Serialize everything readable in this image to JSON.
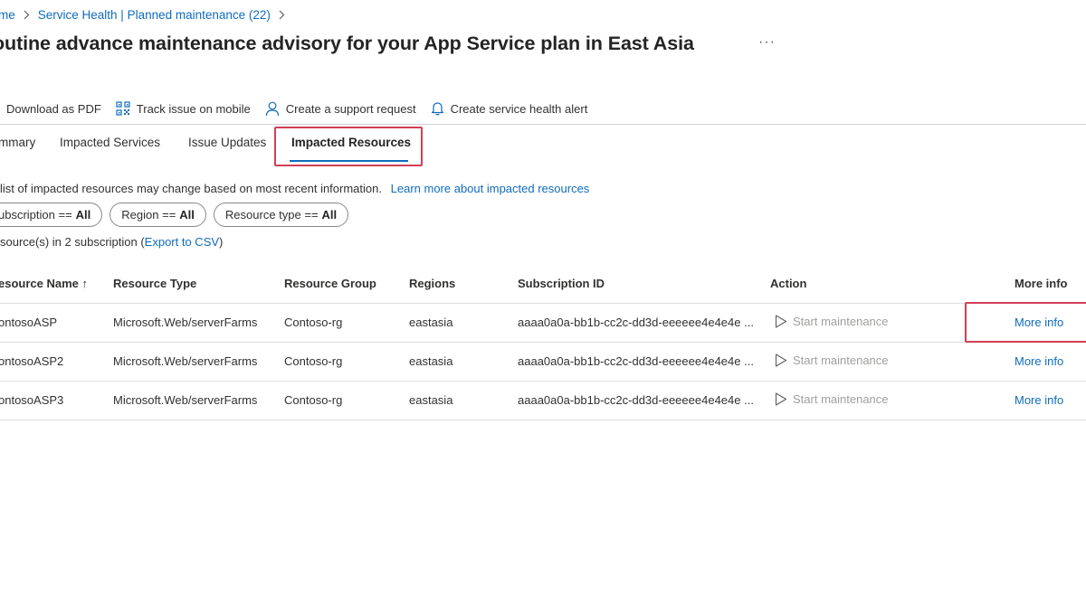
{
  "breadcrumb": {
    "home": "me",
    "current": "Service Health | Planned maintenance (22)"
  },
  "title": "outine advance maintenance advisory for your App Service plan in East Asia",
  "title_more": "···",
  "toolbar": {
    "download": "Download as PDF",
    "track": "Track issue on mobile",
    "support": "Create a support request",
    "alert": "Create service health alert"
  },
  "tabs": {
    "summary": "mmary",
    "impacted_services": "Impacted Services",
    "issue_updates": "Issue Updates",
    "impacted_resources": "Impacted Resources"
  },
  "info": {
    "text": "list of impacted resources may change based on most recent information.",
    "link": "Learn more about impacted resources"
  },
  "filters": {
    "subscription_label": "ubscription ==",
    "subscription_value": "All",
    "region_label": "Region ==",
    "region_value": "All",
    "resource_type_label": "Resource type ==",
    "resource_type_value": "All"
  },
  "count": {
    "prefix": "source(s) in 2 subscription (",
    "link": "Export to CSV",
    "suffix": ")"
  },
  "table": {
    "headers": {
      "name": "esource Name ↑",
      "type": "Resource Type",
      "group": "Resource Group",
      "regions": "Regions",
      "subscription": "Subscription ID",
      "action": "Action",
      "more": "More info"
    },
    "rows": [
      {
        "name": "ontosoASP",
        "type": "Microsoft.Web/serverFarms",
        "group": "Contoso-rg",
        "region": "eastasia",
        "subscription": "aaaa0a0a-bb1b-cc2c-dd3d-eeeeee4e4e4e ...",
        "action": "Start maintenance",
        "more": "More info"
      },
      {
        "name": "ontosoASP2",
        "type": "Microsoft.Web/serverFarms",
        "group": "Contoso-rg",
        "region": "eastasia",
        "subscription": "aaaa0a0a-bb1b-cc2c-dd3d-eeeeee4e4e4e ...",
        "action": "Start maintenance",
        "more": "More info"
      },
      {
        "name": "ontosoASP3",
        "type": "Microsoft.Web/serverFarms",
        "group": "Contoso-rg",
        "region": "eastasia",
        "subscription": "aaaa0a0a-bb1b-cc2c-dd3d-eeeeee4e4e4e ...",
        "action": "Start maintenance",
        "more": "More info"
      }
    ]
  },
  "colors": {
    "link": "#0f6cbd",
    "highlight": "#d13f55",
    "disabled": "#a19f9d"
  }
}
